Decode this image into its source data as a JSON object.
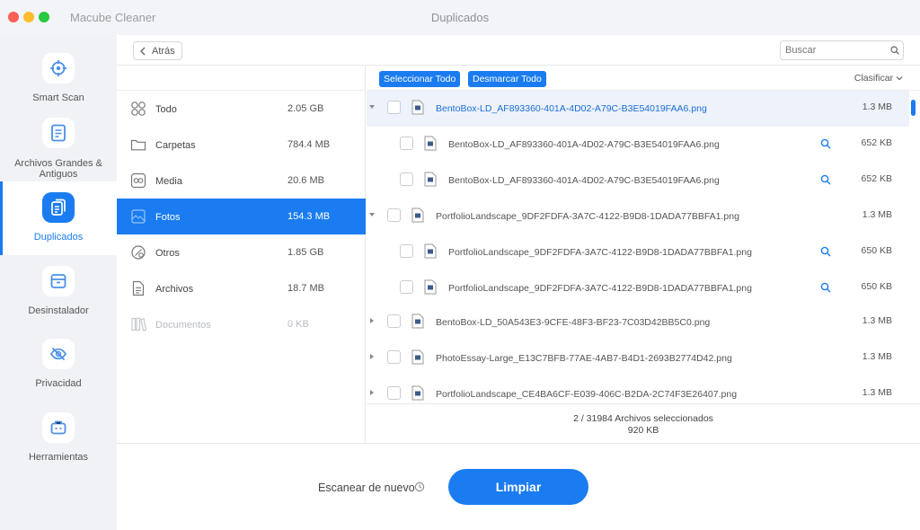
{
  "app": {
    "name": "Macube Cleaner",
    "window_title": "Duplicados"
  },
  "colors": {
    "accent": "#1a7cf0",
    "sidebar_bg": "#f0f2f5"
  },
  "sidebar": {
    "items": [
      {
        "label": "Smart Scan",
        "icon": "crosshair-icon",
        "active": false
      },
      {
        "label": "Archivos Grandes & Antiguos",
        "icon": "document-icon",
        "active": false
      },
      {
        "label": "Duplicados",
        "icon": "duplicate-files-icon",
        "active": true
      },
      {
        "label": "Desinstalador",
        "icon": "box-icon",
        "active": false
      },
      {
        "label": "Privacidad",
        "icon": "eye-slash-icon",
        "active": false
      },
      {
        "label": "Herramientas",
        "icon": "toolbox-icon",
        "active": false
      }
    ]
  },
  "header": {
    "back_label": "Atrás",
    "search_placeholder": "Buscar"
  },
  "categories": [
    {
      "label": "Todo",
      "size": "2.05 GB",
      "icon": "grid-icon",
      "active": false,
      "disabled": false
    },
    {
      "label": "Carpetas",
      "size": "784.4 MB",
      "icon": "folder-icon",
      "active": false,
      "disabled": false
    },
    {
      "label": "Media",
      "size": "20.6 MB",
      "icon": "media-icon",
      "active": false,
      "disabled": false
    },
    {
      "label": "Fotos",
      "size": "154.3 MB",
      "icon": "photo-icon",
      "active": true,
      "disabled": false
    },
    {
      "label": "Otros",
      "size": "1.85 GB",
      "icon": "other-icon",
      "active": false,
      "disabled": false
    },
    {
      "label": "Archivos",
      "size": "18.7 MB",
      "icon": "file-icon",
      "active": false,
      "disabled": false
    },
    {
      "label": "Documentos",
      "size": "0 KB",
      "icon": "books-icon",
      "active": false,
      "disabled": true
    }
  ],
  "toolbar": {
    "select_all": "Seleccionar Todo",
    "deselect_all": "Desmarcar Todo",
    "sort": "Clasificar"
  },
  "files": [
    {
      "name": "BentoBox-LD_AF893360-401A-4D02-A79C-B3E54019FAA6.png",
      "size": "1.3 MB",
      "level": 0,
      "expanded": true,
      "highlighted": true
    },
    {
      "name": "BentoBox-LD_AF893360-401A-4D02-A79C-B3E54019FAA6.png",
      "size": "652 KB",
      "level": 1
    },
    {
      "name": "BentoBox-LD_AF893360-401A-4D02-A79C-B3E54019FAA6.png",
      "size": "652 KB",
      "level": 1
    },
    {
      "name": "PortfolioLandscape_9DF2FDFA-3A7C-4122-B9D8-1DADA77BBFA1.png",
      "size": "1.3 MB",
      "level": 0,
      "expanded": true
    },
    {
      "name": "PortfolioLandscape_9DF2FDFA-3A7C-4122-B9D8-1DADA77BBFA1.png",
      "size": "650 KB",
      "level": 1
    },
    {
      "name": "PortfolioLandscape_9DF2FDFA-3A7C-4122-B9D8-1DADA77BBFA1.png",
      "size": "650 KB",
      "level": 1
    },
    {
      "name": "BentoBox-LD_50A543E3-9CFE-48F3-BF23-7C03D42BB5C0.png",
      "size": "1.3 MB",
      "level": 0,
      "expanded": false
    },
    {
      "name": "PhotoEssay-Large_E13C7BFB-77AE-4AB7-B4D1-2693B2774D42.png",
      "size": "1.3 MB",
      "level": 0,
      "expanded": false
    },
    {
      "name": "PortfolioLandscape_CE4BA6CF-E039-406C-B2DA-2C74F3E26407.png",
      "size": "1.3 MB",
      "level": 0,
      "expanded": false
    }
  ],
  "summary": {
    "selected": "2 / 31984 Archivos seleccionados",
    "size": "920 KB"
  },
  "footer": {
    "rescan_label": "Escanear de nuevo",
    "clean_label": "Limpiar"
  }
}
